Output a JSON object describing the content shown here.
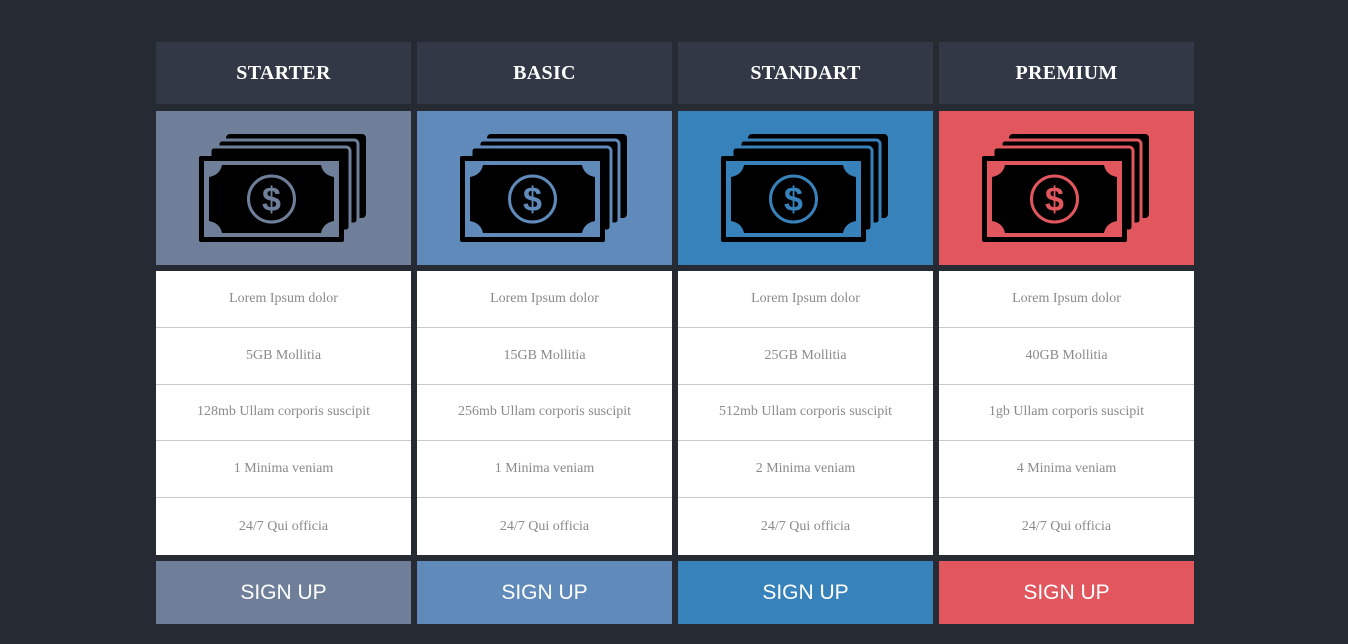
{
  "plans": [
    {
      "name": "STARTER",
      "color": "#6f7f9a",
      "features": [
        "Lorem Ipsum dolor",
        "5GB Mollitia",
        "128mb Ullam corporis suscipit",
        "1 Minima veniam",
        "24/7 Qui officia"
      ],
      "button_label": "SIGN UP",
      "icon": "money-bills-icon"
    },
    {
      "name": "BASIC",
      "color": "#5f8aba",
      "features": [
        "Lorem Ipsum dolor",
        "15GB Mollitia",
        "256mb Ullam corporis suscipit",
        "1 Minima veniam",
        "24/7 Qui officia"
      ],
      "button_label": "SIGN UP",
      "icon": "money-bills-icon"
    },
    {
      "name": "STANDART",
      "color": "#3882bc",
      "features": [
        "Lorem Ipsum dolor",
        "25GB Mollitia",
        "512mb Ullam corporis suscipit",
        "2 Minima veniam",
        "24/7 Qui officia"
      ],
      "button_label": "SIGN UP",
      "icon": "money-bills-icon"
    },
    {
      "name": "PREMIUM",
      "color": "#e2565e",
      "features": [
        "Lorem Ipsum dolor",
        "40GB Mollitia",
        "1gb Ullam corporis suscipit",
        "4 Minima veniam",
        "24/7 Qui officia"
      ],
      "button_label": "SIGN UP",
      "icon": "money-bills-icon"
    }
  ]
}
